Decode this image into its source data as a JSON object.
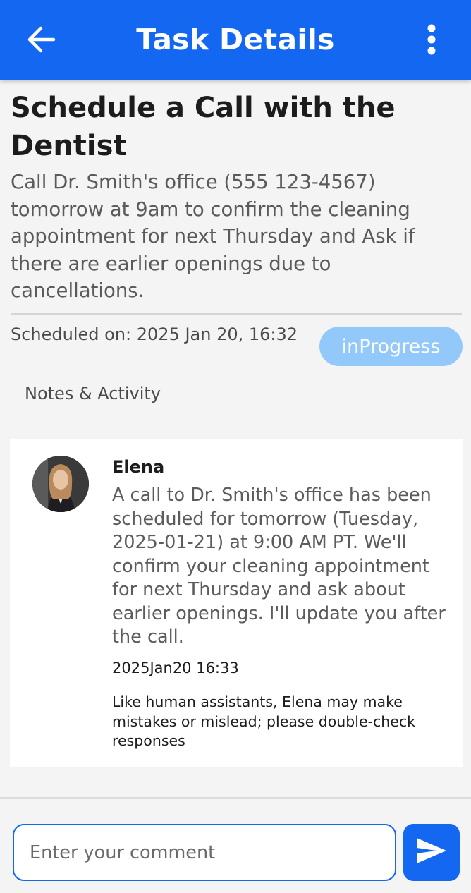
{
  "header": {
    "title": "Task Details",
    "back_icon": "arrow-left-icon",
    "menu_icon": "more-vertical-icon",
    "color": "#1467f0"
  },
  "task": {
    "title": "Schedule a Call with the Dentist",
    "description": "Call Dr. Smith's office (555 123-4567) tomorrow at 9am to confirm the cleaning appointment for next Thursday and Ask if there are earlier openings due to cancellations.",
    "scheduled": "Scheduled on: 2025 Jan 20, 16:32",
    "status": "inProgress",
    "status_color": "#92c9fa"
  },
  "notes": {
    "heading": "Notes & Activity",
    "items": [
      {
        "author": "Elena",
        "avatar_icon": "avatar-photo",
        "message": "A call to Dr. Smith's office has been scheduled for tomorrow (Tuesday, 2025-01-21) at 9:00 AM PT. We'll confirm your cleaning appointment for next Thursday and ask about earlier openings. I'll update you after the call.",
        "timestamp": "2025Jan20 16:33",
        "disclaimer": "Like human assistants, Elena may make mistakes or mislead; please double-check responses"
      }
    ]
  },
  "composer": {
    "placeholder": "Enter your comment",
    "value": "",
    "send_icon": "send-icon"
  }
}
